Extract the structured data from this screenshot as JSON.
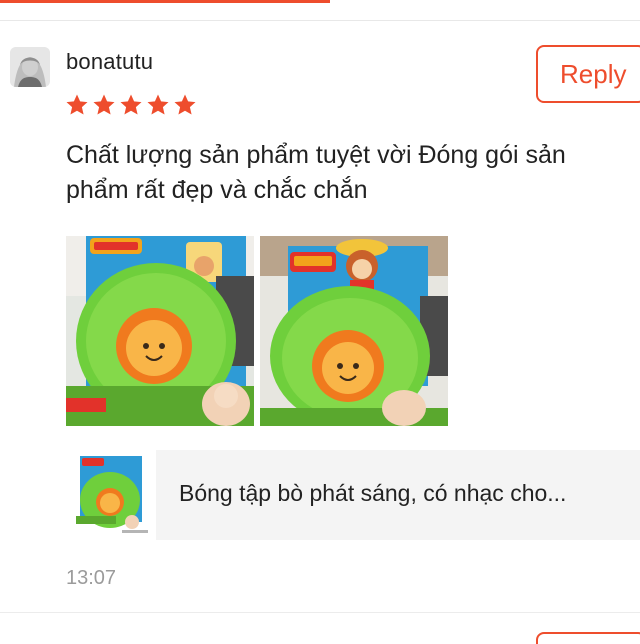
{
  "review": {
    "username": "bonatutu",
    "rating": 5,
    "reply_label": "Reply",
    "comment": "Chất lượng sản phẩm tuyệt vời Đóng gói sản phẩm rất đẹp và chắc chắn",
    "timestamp": "13:07"
  },
  "product": {
    "name": "Bóng tập bò phát sáng, có nhạc cho..."
  },
  "icons": [
    "avatar",
    "star-icon",
    "review-photo",
    "product-thumbnail"
  ],
  "colors": {
    "accent": "#ee4d2d",
    "star": "#ee4d2d",
    "timestamp": "#9b9b9b",
    "product_card_bg": "#f4f4f4"
  }
}
